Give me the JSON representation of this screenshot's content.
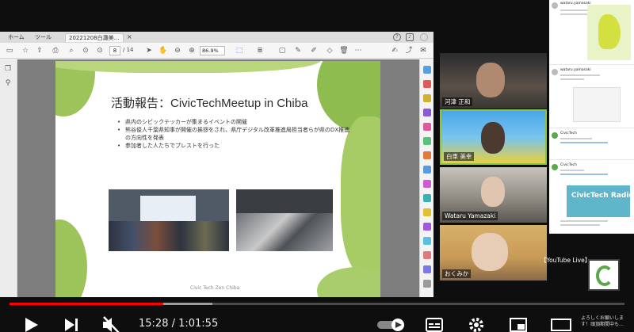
{
  "pdf_viewer": {
    "tabs": {
      "home": "ホーム",
      "tools": "ツール",
      "document": "20221208白灘美…"
    },
    "toolbar": {
      "page_current": "8",
      "page_total": "/ 14",
      "zoom": "86.9%"
    }
  },
  "slide": {
    "title": "活動報告：CivicTechMeetup in Chiba",
    "bullets": [
      "県内のシビックテッカーが集まるイベントの開催",
      "熊谷俊人千葉県知事が開催の挨拶をされ、県庁デジタル改革推進局担当者らが県のDX推進の方向性を発表",
      "参加者した人たちでプレストを行った"
    ],
    "footer": "Civic Tech Zen Chiba"
  },
  "participants": [
    {
      "name": "河津 正和"
    },
    {
      "name": "白車 美幸"
    },
    {
      "name": "Wataru Yamazaki"
    },
    {
      "name": "おくみか"
    }
  ],
  "tweets": [
    {
      "name": "wataru.yamasaki"
    },
    {
      "name": "wataru.yamasaki"
    },
    {
      "name": "CivicTech"
    },
    {
      "name": "CivicTech"
    }
  ],
  "overlay": {
    "youtube_live": "【YouTube Live】",
    "radio_title": "CivicTech Radio"
  },
  "player": {
    "current_time": "15:28",
    "duration": "1:01:55",
    "time_display": "15:28 / 1:01:55",
    "progress_fraction": 0.25,
    "buffered_fraction": 0.33,
    "notice_text": "よろしくお願いします！頭頂期間中も…",
    "accent": "#ff0000"
  },
  "colors": {
    "slide_green": "#9dc45a",
    "highlight_border": "#8cc63f",
    "radio_bg": "#5fb5c9"
  }
}
